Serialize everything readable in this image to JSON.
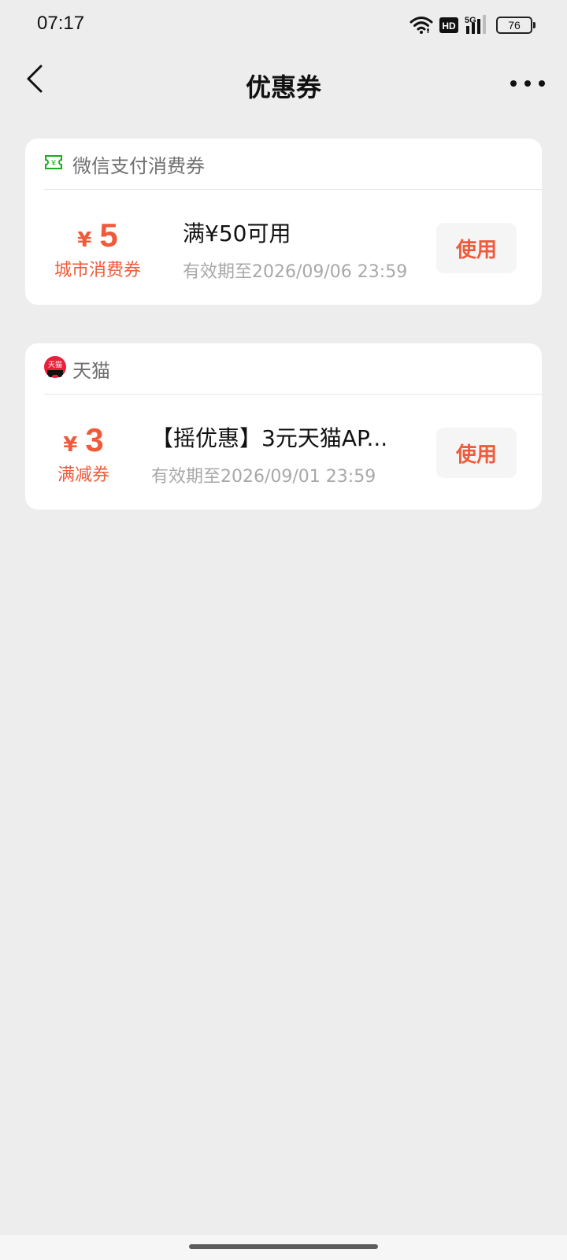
{
  "status_bar": {
    "time": "07:17",
    "icons": [
      "wifi-icon",
      "hd-icon",
      "5g-signal-icon",
      "battery-icon"
    ],
    "hd_label": "HD",
    "network_label": "5G",
    "battery_level": "76"
  },
  "nav": {
    "title": "优惠券",
    "back_icon": "chevron-left-icon",
    "more_icon": "more-dots-icon"
  },
  "coupons": [
    {
      "brand": "微信支付消费券",
      "brand_icon": "wechat-pay-coupon-icon",
      "currency": "¥",
      "amount": "5",
      "type": "城市消费券",
      "description": "满¥50可用",
      "validity": "有效期至2026/09/06 23:59",
      "action": "使用"
    },
    {
      "brand": "天猫",
      "brand_icon": "tmall-logo-icon",
      "brand_icon_text": "天猫",
      "currency": "¥",
      "amount": "3",
      "type": "满减券",
      "description": "【摇优惠】3元天猫AP...",
      "validity": "有效期至2026/09/01 23:59",
      "action": "使用"
    }
  ],
  "colors": {
    "background": "#ededed",
    "card": "#ffffff",
    "accent": "#f05a3b",
    "wechat_green": "#1aad19",
    "tmall_red": "#e8203a"
  }
}
